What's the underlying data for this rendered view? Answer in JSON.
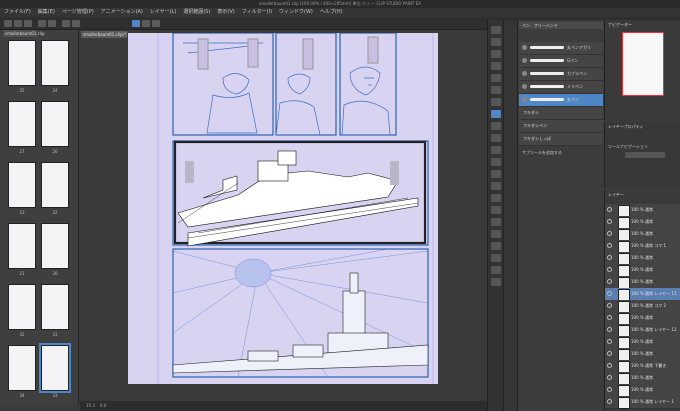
{
  "window": {
    "title": "smallerbaum01.clip [100.00% / 400×285mm] 単位:ミリ — CLIP STUDIO PAINT EX"
  },
  "menu": {
    "items": [
      "ファイル(F)",
      "編集(E)",
      "ページ管理(P)",
      "アニメーション(A)",
      "レイヤー(L)",
      "選択範囲(S)",
      "表示(V)",
      "フィルター(I)",
      "ウィンドウ(W)",
      "ヘルプ(H)"
    ]
  },
  "page_panel": {
    "tab": "smallerbaum01.clip",
    "page_numbers": [
      "25",
      "24",
      "27",
      "26",
      "23",
      "22",
      "21",
      "30",
      "32",
      "31",
      "34",
      "33"
    ]
  },
  "canvas": {
    "document_tab": "smallerbaum01.clip(*)"
  },
  "status": {
    "zoom": "15.3",
    "position": "0.0"
  },
  "subtool": {
    "header_tabs": [
      "ペン",
      "フリーハンド"
    ],
    "pens": [
      "丸ペンアガリ",
      "Gペン",
      "カブラペン",
      "ミリペン",
      "丸ペン"
    ],
    "extra_labels": [
      "フキダシ",
      "フキダシペン",
      "フキダシしっぽ"
    ],
    "add_button": "サブツールを追加する"
  },
  "navigator": {
    "header": "ナビゲーター",
    "layer_property": "レイヤープロパティ",
    "effect": "ツールナビゲーション"
  },
  "layers": {
    "header": "レイヤー",
    "items": [
      {
        "label": "100 % 通常"
      },
      {
        "label": "100 % 通常"
      },
      {
        "label": "100 % 通常"
      },
      {
        "label": "100 % 通常 コマ 1"
      },
      {
        "label": "100 % 通常"
      },
      {
        "label": "100 % 通常"
      },
      {
        "label": "100 % 通常"
      },
      {
        "label": "100 % 通常 レイヤー 11"
      },
      {
        "label": "100 % 通常 コマ 2"
      },
      {
        "label": "100 % 通常"
      },
      {
        "label": "100 % 通常 レイヤー 12"
      },
      {
        "label": "100 % 通常"
      },
      {
        "label": "100 % 通常"
      },
      {
        "label": "100 % 通常 下書き"
      },
      {
        "label": "100 % 通常"
      },
      {
        "label": "100 % 通常"
      },
      {
        "label": "100 % 通常 レイヤー 1"
      }
    ]
  },
  "colors": {
    "accent": "#4f86c6",
    "paper": "#d8d3f1",
    "panel_border": "#2b63b5"
  }
}
